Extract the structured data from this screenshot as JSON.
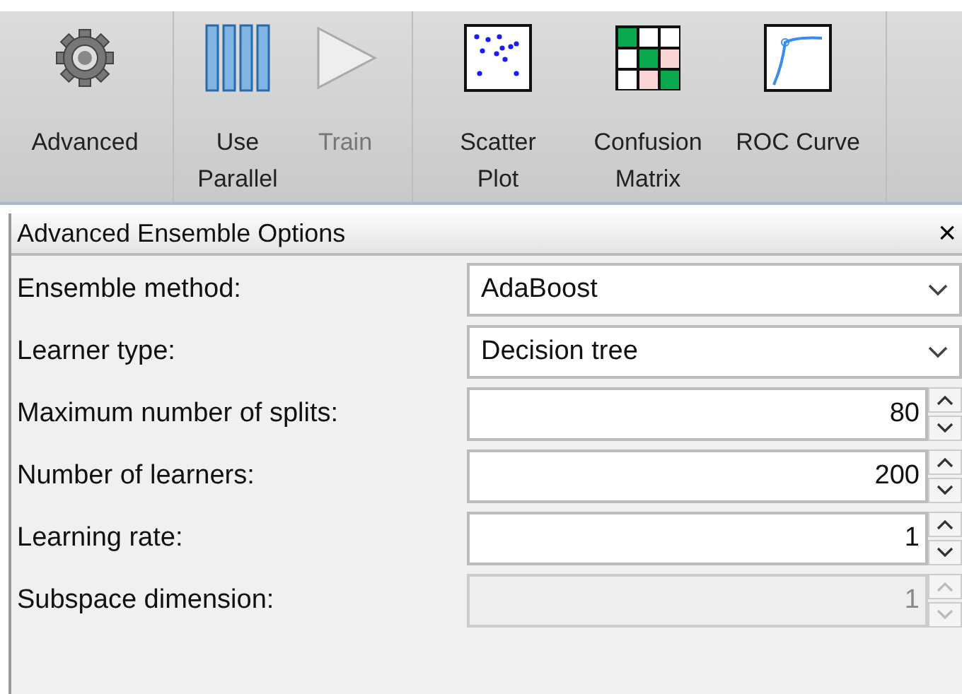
{
  "toolbar": {
    "groups": [
      [
        {
          "label": "Advanced",
          "kind": "gear",
          "disabled": false
        }
      ],
      [
        {
          "label": "Use\nParallel",
          "kind": "parallel",
          "disabled": false
        },
        {
          "label": "Train",
          "kind": "play",
          "disabled": true
        }
      ],
      [
        {
          "label": "Scatter\nPlot",
          "kind": "scatter",
          "disabled": false
        },
        {
          "label": "Confusion\nMatrix",
          "kind": "matrix",
          "disabled": false
        },
        {
          "label": "ROC Curve",
          "kind": "roc",
          "disabled": false
        }
      ]
    ]
  },
  "panel": {
    "title": "Advanced Ensemble Options",
    "close": "×",
    "rows": [
      {
        "label": "Ensemble method:",
        "kind": "dropdown",
        "value": "AdaBoost",
        "disabled": false
      },
      {
        "label": "Learner type:",
        "kind": "dropdown",
        "value": "Decision tree",
        "disabled": false
      },
      {
        "label": "Maximum number of splits:",
        "kind": "spinner",
        "value": "80",
        "disabled": false
      },
      {
        "label": "Number of learners:",
        "kind": "spinner",
        "value": "200",
        "disabled": false
      },
      {
        "label": "Learning rate:",
        "kind": "spinner",
        "value": "1",
        "disabled": false
      },
      {
        "label": "Subspace dimension:",
        "kind": "spinner",
        "value": "1",
        "disabled": true
      }
    ]
  }
}
